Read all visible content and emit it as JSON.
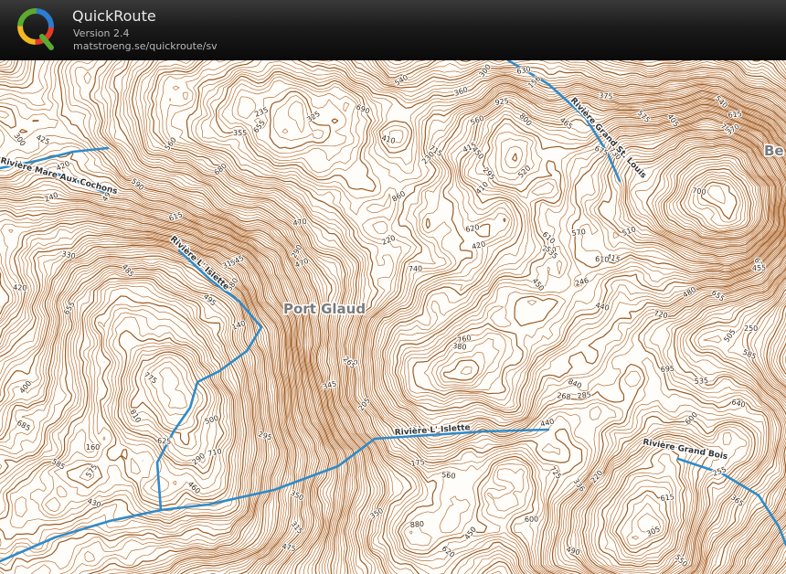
{
  "app": {
    "name": "QuickRoute",
    "version": "Version 2.4",
    "url": "matstroeng.se/quickroute/sv",
    "logo_letter": "Q"
  },
  "map": {
    "place_labels": [
      "Port Glaud",
      "Be"
    ],
    "river_labels": [
      "Rivière Mare Aux Cochons",
      "Rivière L' Islette",
      "Rivière L' Islette",
      "Rivière Grand St. Louis",
      "Rivière Grand Bois"
    ],
    "elevation_labels": [
      "655",
      "620",
      "725",
      "775",
      "760",
      "810",
      "800",
      "695",
      "730",
      "720",
      "860",
      "880",
      "550",
      "560",
      "440",
      "450",
      "430",
      "470",
      "420",
      "415",
      "425",
      "420",
      "405",
      "390",
      "410",
      "400",
      "480",
      "490",
      "505",
      "615",
      "615",
      "585",
      "600",
      "655",
      "685",
      "680",
      "700",
      "740",
      "675",
      "670",
      "690",
      "715",
      "710",
      "925",
      "840",
      "780",
      "355",
      "345",
      "370",
      "310",
      "300",
      "295",
      "315",
      "305",
      "290",
      "285",
      "255",
      "250",
      "268",
      "295",
      "380",
      "290",
      "325",
      "350",
      "415",
      "470",
      "410",
      "460",
      "455",
      "450",
      "475",
      "450",
      "375",
      "380",
      "360",
      "420",
      "490",
      "500",
      "540",
      "575",
      "610",
      "615",
      "640",
      "620",
      "655",
      "630",
      "600",
      "570",
      "545",
      "535",
      "520",
      "510",
      "440",
      "485",
      "465",
      "495",
      "510",
      "535",
      "560",
      "590",
      "610",
      "625",
      "540",
      "575",
      "585",
      "560",
      "160",
      "156",
      "140",
      "175",
      "205",
      "250",
      "235",
      "220",
      "230",
      "246",
      "300",
      "330",
      "365",
      "336",
      "220",
      "240",
      "265",
      "350"
    ],
    "colors": {
      "contour": "#b8723a",
      "contour_dark": "#9a5a24",
      "river": "#2f8bc9",
      "background": "#fffdf9"
    }
  }
}
